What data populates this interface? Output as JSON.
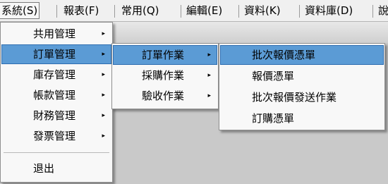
{
  "menubar": {
    "items": [
      {
        "label": "系統(S)"
      },
      {
        "label": "報表(F)"
      },
      {
        "label": "常用(Q)"
      },
      {
        "label": "編輯(E)"
      },
      {
        "label": "資料(K)"
      },
      {
        "label": "資料庫(D)"
      },
      {
        "label": "說"
      }
    ]
  },
  "menu1": {
    "items": [
      {
        "label": "共用管理"
      },
      {
        "label": "訂單管理"
      },
      {
        "label": "庫存管理"
      },
      {
        "label": "帳款管理"
      },
      {
        "label": "財務管理"
      },
      {
        "label": "發票管理"
      },
      {
        "label": "退出"
      }
    ]
  },
  "menu2": {
    "items": [
      {
        "label": "訂單作業"
      },
      {
        "label": "採購作業"
      },
      {
        "label": "驗收作業"
      }
    ]
  },
  "menu3": {
    "items": [
      {
        "label": "批次報價憑單"
      },
      {
        "label": "報價憑單"
      },
      {
        "label": "批次報價發送作業"
      },
      {
        "label": "訂購憑單"
      }
    ]
  },
  "icons": {
    "submenu_arrow": "▸"
  },
  "colors": {
    "highlight": "#5b9bd5",
    "menu_bg": "#f8f8f8"
  }
}
